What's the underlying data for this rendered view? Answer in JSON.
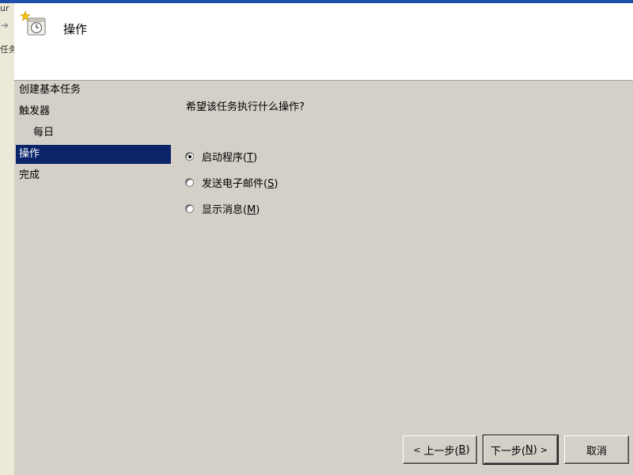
{
  "background_app": {
    "text_1": "ur",
    "text_2": "任务"
  },
  "header": {
    "title": "操作",
    "icon": "task-scheduler-clock-icon"
  },
  "sidebar": {
    "items": [
      {
        "label": "创建基本任务"
      },
      {
        "label": "触发器"
      },
      {
        "label": "每日"
      },
      {
        "label": "操作"
      },
      {
        "label": "完成"
      }
    ],
    "selected_index": 3
  },
  "content": {
    "question": "希望该任务执行什么操作?",
    "options": [
      {
        "text": "启动程序(",
        "key": "T",
        "close": ")",
        "selected": true
      },
      {
        "text": "发送电子邮件(",
        "key": "S",
        "close": ")",
        "selected": false
      },
      {
        "text": "显示消息(",
        "key": "M",
        "close": ")",
        "selected": false
      }
    ]
  },
  "buttons": {
    "back": {
      "lt": "<",
      "text": "上一步(",
      "key": "B",
      "close": ")"
    },
    "next": {
      "text": "下一步(",
      "key": "N",
      "close": ")",
      "gt": ">"
    },
    "cancel": {
      "text": "取消"
    }
  },
  "colors": {
    "selection": "#0a246a",
    "dialog_bg": "#d4d0c8",
    "header_bg": "#ffffff",
    "title_strip": "#1c4fa8"
  }
}
